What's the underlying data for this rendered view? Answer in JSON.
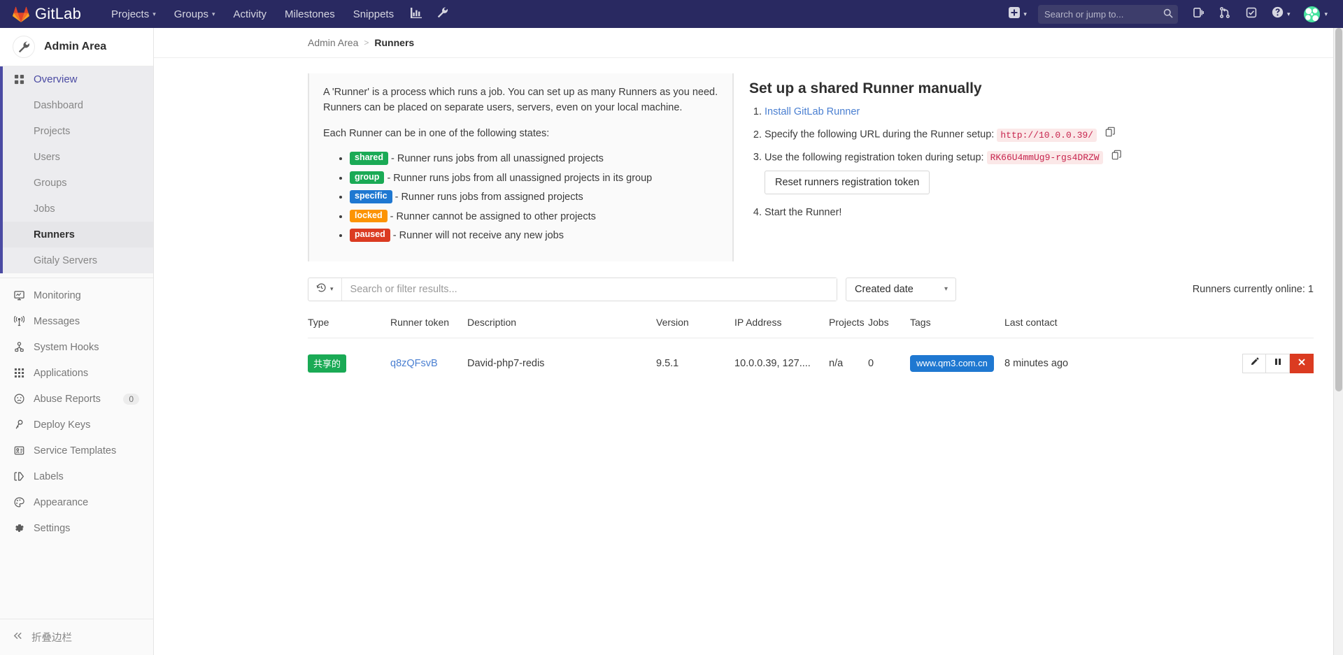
{
  "topnav": {
    "brand": "GitLab",
    "items": [
      {
        "label": "Projects",
        "caret": true
      },
      {
        "label": "Groups",
        "caret": true
      },
      {
        "label": "Activity",
        "caret": false
      },
      {
        "label": "Milestones",
        "caret": false
      },
      {
        "label": "Snippets",
        "caret": false
      }
    ],
    "icon_analytics": "chart-icon",
    "icon_admin": "wrench-icon",
    "plus_label": "plus-icon",
    "search_placeholder": "Search or jump to...",
    "search_value": "",
    "icon_issues": "issues-icon",
    "icon_merge_requests": "merge-request-icon",
    "icon_todos": "todos-icon",
    "icon_help": "help-icon",
    "icon_avatar": "user-avatar"
  },
  "sidebar": {
    "title": "Admin Area",
    "overview": {
      "label": "Overview",
      "children": [
        {
          "label": "Dashboard",
          "current": false
        },
        {
          "label": "Projects",
          "current": false
        },
        {
          "label": "Users",
          "current": false
        },
        {
          "label": "Groups",
          "current": false
        },
        {
          "label": "Jobs",
          "current": false
        },
        {
          "label": "Runners",
          "current": true
        },
        {
          "label": "Gitaly Servers",
          "current": false
        }
      ]
    },
    "items": [
      {
        "label": "Monitoring",
        "icon": "monitor-icon",
        "badge": null
      },
      {
        "label": "Messages",
        "icon": "broadcast-icon",
        "badge": null
      },
      {
        "label": "System Hooks",
        "icon": "hook-icon",
        "badge": null
      },
      {
        "label": "Applications",
        "icon": "applications-grid-icon",
        "badge": null
      },
      {
        "label": "Abuse Reports",
        "icon": "sad-face-icon",
        "badge": "0"
      },
      {
        "label": "Deploy Keys",
        "icon": "key-icon",
        "badge": null
      },
      {
        "label": "Service Templates",
        "icon": "template-icon",
        "badge": null
      },
      {
        "label": "Labels",
        "icon": "labels-icon",
        "badge": null
      },
      {
        "label": "Appearance",
        "icon": "palette-icon",
        "badge": null
      },
      {
        "label": "Settings",
        "icon": "gear-icon",
        "badge": null
      }
    ],
    "collapse_label": "折叠边栏"
  },
  "breadcrumb": {
    "root": "Admin Area",
    "separator": ">",
    "current": "Runners"
  },
  "info_panel": {
    "paragraph1": "A 'Runner' is a process which runs a job. You can set up as many Runners as you need. Runners can be placed on separate users, servers, even on your local machine.",
    "paragraph2": "Each Runner can be in one of the following states:",
    "states": [
      {
        "badge": "shared",
        "color": "#1aaa55",
        "text": "- Runner runs jobs from all unassigned projects"
      },
      {
        "badge": "group",
        "color": "#1aaa55",
        "text": "- Runner runs jobs from all unassigned projects in its group"
      },
      {
        "badge": "specific",
        "color": "#1f78d1",
        "text": "- Runner runs jobs from assigned projects"
      },
      {
        "badge": "locked",
        "color": "#fc9403",
        "text": "- Runner cannot be assigned to other projects"
      },
      {
        "badge": "paused",
        "color": "#db3b21",
        "text": "- Runner will not receive any new jobs"
      }
    ]
  },
  "setup_panel": {
    "title": "Set up a shared Runner manually",
    "step1_link": "Install GitLab Runner",
    "step2_text": "Specify the following URL during the Runner setup:",
    "step2_code": "http://10.0.0.39/",
    "step3_text": "Use the following registration token during setup:",
    "step3_code": "RK66U4mmUg9-rgs4DRZW",
    "reset_button": "Reset runners registration token",
    "step4_text": "Start the Runner!",
    "copy_icon": "copy-icon"
  },
  "filters": {
    "history_icon": "history-icon",
    "search_placeholder": "Search or filter results...",
    "search_value": "",
    "sort_value": "Created date",
    "online_status": "Runners currently online: 1"
  },
  "table": {
    "columns": [
      "Type",
      "Runner token",
      "Description",
      "Version",
      "IP Address",
      "Projects",
      "Jobs",
      "Tags",
      "Last contact"
    ],
    "rows": [
      {
        "type": "共享的",
        "type_color": "#1aaa55",
        "token": "q8zQFsvB",
        "description": "David-php7-redis",
        "version": "9.5.1",
        "ip_address": "10.0.0.39, 127....",
        "projects": "n/a",
        "jobs": "0",
        "tags": [
          "www.qm3.com.cn"
        ],
        "last_contact": "8 minutes ago",
        "actions": {
          "edit": "pencil-icon",
          "pause": "pause-icon",
          "remove": "close-x-icon"
        }
      }
    ]
  }
}
